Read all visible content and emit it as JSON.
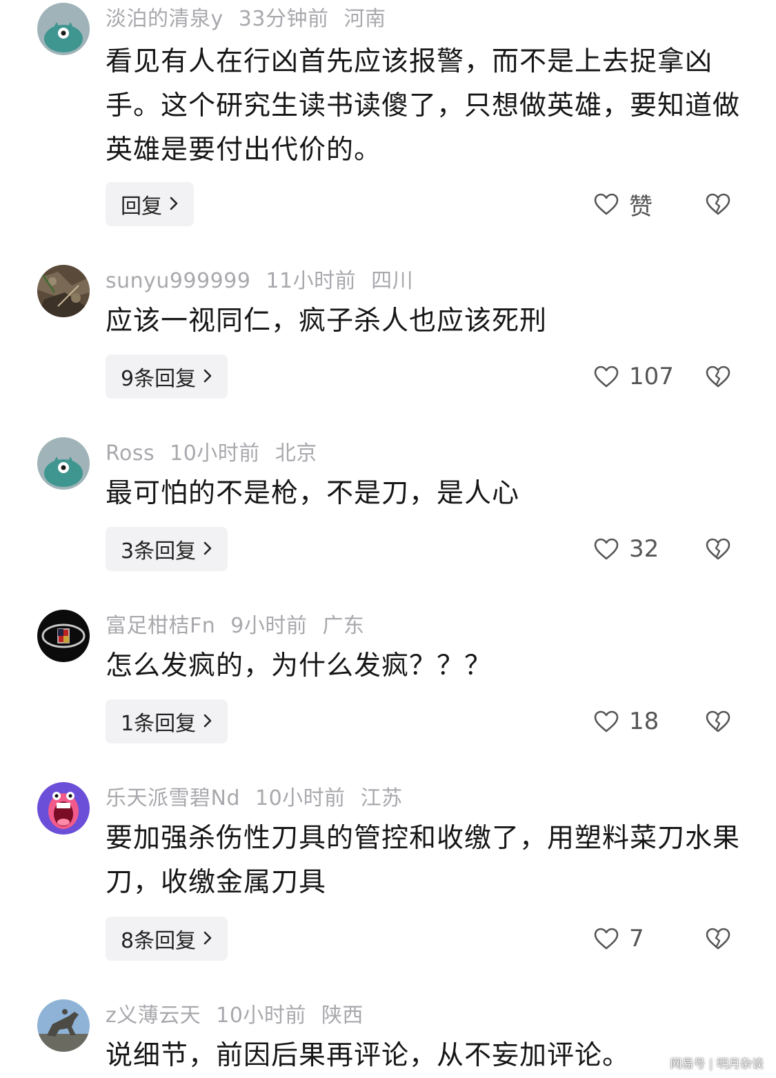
{
  "comments": [
    {
      "author": "淡泊的清泉y",
      "time": "33分钟前",
      "location": "河南",
      "text": "看见有人在行凶首先应该报警，而不是上去捉拿凶手。这个研究生读书读傻了，只想做英雄，要知道做英雄是要付出代价的。",
      "reply_label": "回复",
      "likes": "赞",
      "avatar": "teal-monster-avatar"
    },
    {
      "author": "sunyu999999",
      "time": "11小时前",
      "location": "四川",
      "text": "应该一视同仁，疯子杀人也应该死刑",
      "reply_label": "9条回复",
      "likes": "107",
      "avatar": "photo-leaves-avatar"
    },
    {
      "author": "Ross",
      "time": "10小时前",
      "location": "北京",
      "text": "最可怕的不是枪，不是刀，是人心",
      "reply_label": "3条回复",
      "likes": "32",
      "avatar": "teal-monster-avatar"
    },
    {
      "author": "富足柑桔Fn",
      "time": "9小时前",
      "location": "广东",
      "text": "怎么发疯的，为什么发疯？？？",
      "reply_label": "1条回复",
      "likes": "18",
      "avatar": "car-emblem-avatar"
    },
    {
      "author": "乐天派雪碧Nd",
      "time": "10小时前",
      "location": "江苏",
      "text": "要加强杀伤性刀具的管控和收缴了，用塑料菜刀水果刀，收缴金属刀具",
      "reply_label": "8条回复",
      "likes": "7",
      "avatar": "screaming-cartoon-avatar"
    },
    {
      "author": "z义薄云天",
      "time": "10小时前",
      "location": "陕西",
      "text": "说细节，前因后果再评论，从不妄加评论。",
      "avatar": "horse-statue-avatar"
    }
  ],
  "icons": {
    "like": "heart-outline-icon",
    "dislike": "broken-heart-icon",
    "reply_chevron": "chevron-right-icon"
  },
  "colors": {
    "meta_text": "#a8a8ad",
    "body_text": "#161616",
    "reply_bg": "#f2f2f4",
    "avatar_teal": "#5aa8a4"
  },
  "watermark": "网易号 | 明月杂谈"
}
